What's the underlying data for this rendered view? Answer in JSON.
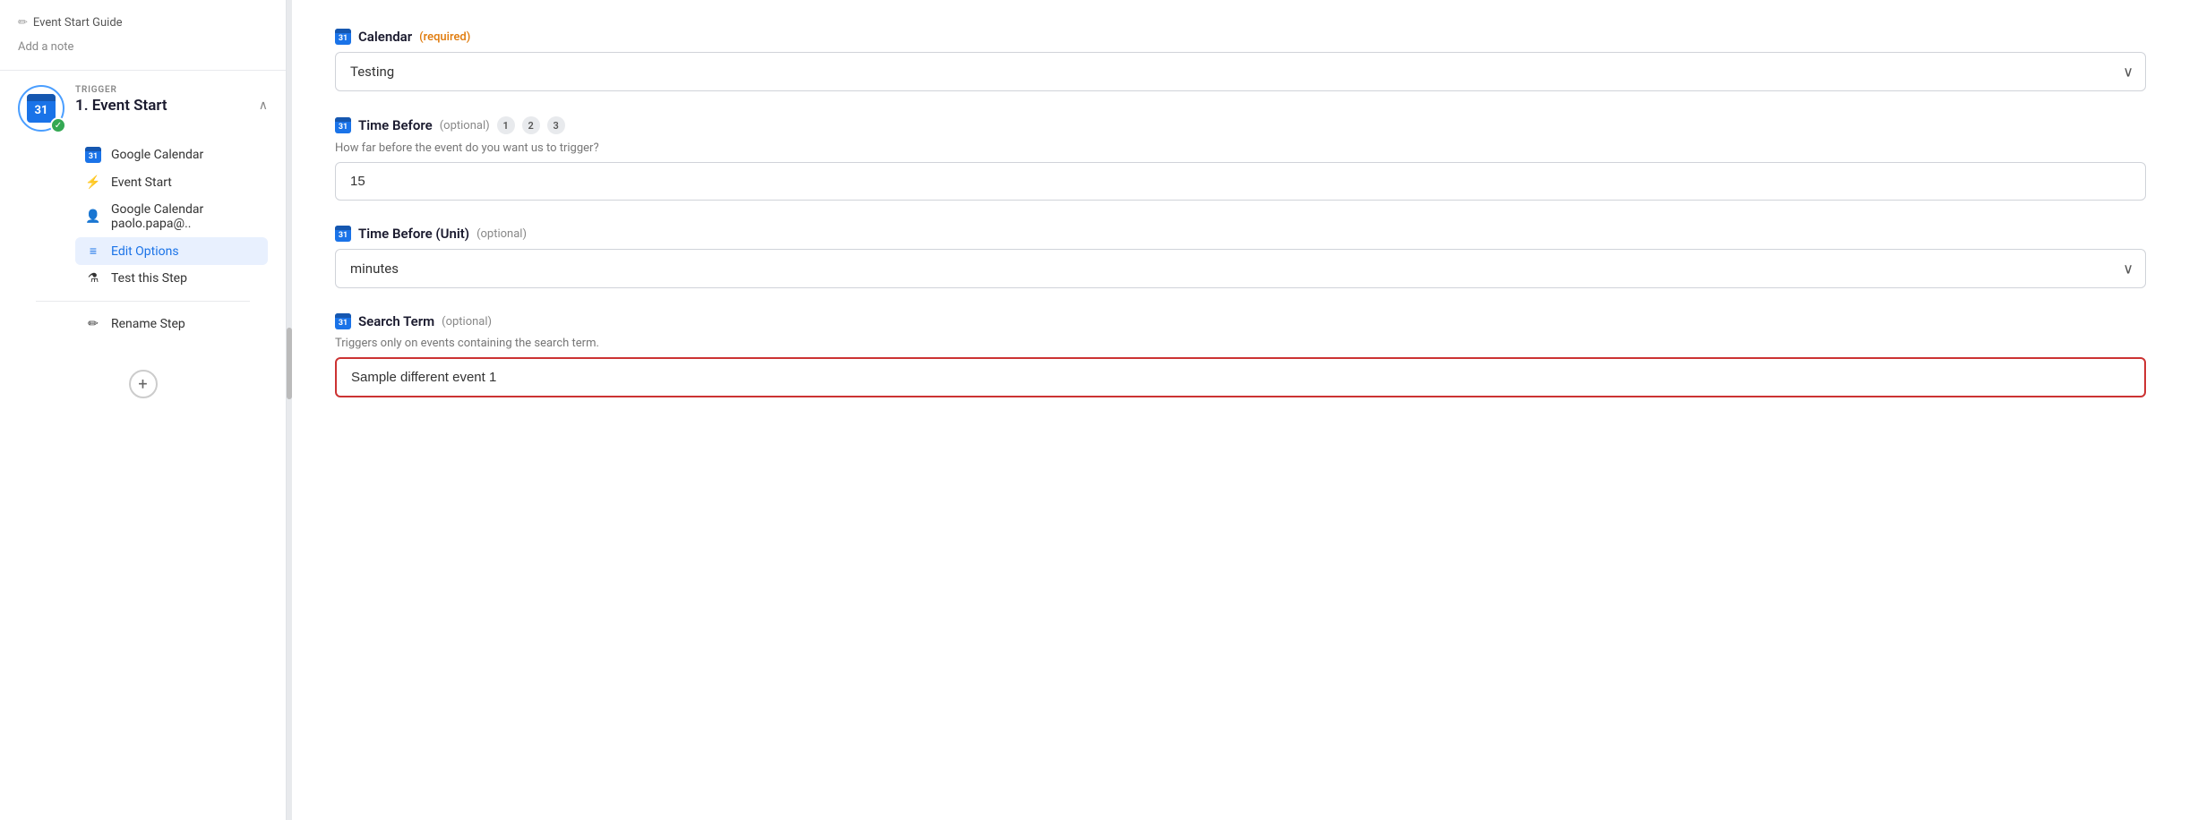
{
  "sidebar": {
    "breadcrumb": "Event Start Guide",
    "add_note": "Add a note",
    "trigger": {
      "label": "TRIGGER",
      "title": "1. Event Start",
      "icon_number": "31"
    },
    "sub_items": [
      {
        "id": "google-calendar",
        "label": "Google Calendar",
        "icon": "cal"
      },
      {
        "id": "event-start",
        "label": "Event Start",
        "icon": "bolt"
      },
      {
        "id": "account",
        "label": "Google Calendar paolo.papa@..",
        "icon": "person"
      },
      {
        "id": "edit-options",
        "label": "Edit Options",
        "icon": "lines",
        "active": true
      },
      {
        "id": "test-step",
        "label": "Test this Step",
        "icon": "flask"
      }
    ],
    "rename_label": "Rename Step",
    "add_step_label": "+"
  },
  "main": {
    "fields": [
      {
        "id": "calendar",
        "label": "Calendar",
        "modifier": "required",
        "modifier_text": "(required)",
        "hint": "",
        "type": "select",
        "value": "Testing",
        "highlighted": false
      },
      {
        "id": "time-before",
        "label": "Time Before",
        "modifier": "optional",
        "modifier_text": "(optional)",
        "extra_badges": [
          "1",
          "2",
          "3"
        ],
        "hint": "How far before the event do you want us to trigger?",
        "type": "input",
        "value": "15",
        "highlighted": false
      },
      {
        "id": "time-before-unit",
        "label": "Time Before (Unit)",
        "modifier": "optional",
        "modifier_text": "(optional)",
        "hint": "",
        "type": "select",
        "value": "minutes",
        "highlighted": false
      },
      {
        "id": "search-term",
        "label": "Search Term",
        "modifier": "optional",
        "modifier_text": "(optional)",
        "hint": "Triggers only on events containing the search term.",
        "type": "input",
        "value": "Sample different event 1",
        "highlighted": true
      }
    ]
  },
  "icons": {
    "cal_number": "31",
    "bolt": "⚡",
    "person": "👤",
    "lines": "≡",
    "flask": "⚗",
    "pencil": "✏",
    "chevron_up": "∧",
    "chevron_down": "∨",
    "checkmark": "✓",
    "plus": "+"
  }
}
